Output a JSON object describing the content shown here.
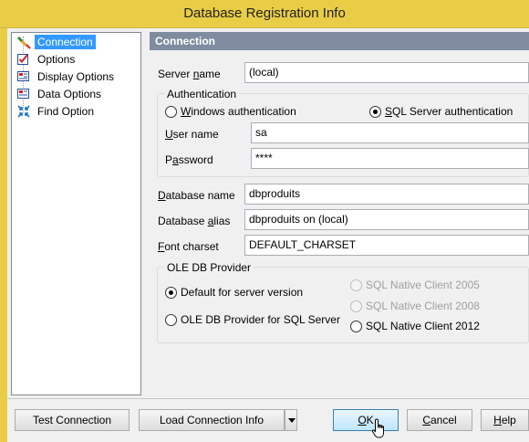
{
  "window": {
    "title": "Database Registration Info"
  },
  "tree": {
    "items": [
      {
        "label": "Connection",
        "icon": "connection-plug-icon",
        "selected": true
      },
      {
        "label": "Options",
        "icon": "options-checkbox-icon",
        "selected": false
      },
      {
        "label": "Display Options",
        "icon": "display-options-icon",
        "selected": false
      },
      {
        "label": "Data Options",
        "icon": "data-options-icon",
        "selected": false
      },
      {
        "label": "Find Option",
        "icon": "find-arrows-icon",
        "selected": false
      }
    ]
  },
  "section": {
    "title": "Connection"
  },
  "form": {
    "server_name": {
      "label_pre": "Server ",
      "label_ul": "n",
      "label_post": "ame",
      "value": "(local)"
    },
    "authentication": {
      "title": "Authentication",
      "windows": {
        "label_ul": "W",
        "label_post": "indows authentication",
        "selected": false
      },
      "sql": {
        "label_ul": "S",
        "label_post": "QL Server authentication",
        "selected": true
      },
      "user_name": {
        "label_ul": "U",
        "label_post": "ser name",
        "value": "sa"
      },
      "password": {
        "label_pre": "P",
        "label_ul": "a",
        "label_post": "ssword",
        "value": "****"
      }
    },
    "database_name": {
      "label_ul": "D",
      "label_post": "atabase name",
      "value": "dbproduits"
    },
    "database_alias": {
      "label_pre": "Database ",
      "label_ul": "a",
      "label_post": "lias",
      "value": "dbproduits on (local)"
    },
    "font_charset": {
      "label_ul": "F",
      "label_post": "ont charset",
      "value": "DEFAULT_CHARSET"
    },
    "ole_db": {
      "title": "OLE DB Provider",
      "default_version": {
        "label": "Default for server version",
        "selected": true
      },
      "provider_sql": {
        "label": "OLE DB Provider for SQL Server",
        "selected": false
      },
      "native_2005": {
        "label": "SQL Native Client 2005",
        "enabled": false
      },
      "native_2008": {
        "label": "SQL Native Client 2008",
        "enabled": false
      },
      "native_2012": {
        "label": "SQL Native Client 2012",
        "enabled": true
      }
    }
  },
  "buttons": {
    "test_connection": "Test Connection",
    "load_connection_info": "Load Connection Info",
    "ok_ul": "O",
    "ok_post": "K",
    "cancel_ul": "C",
    "cancel_post": "ancel",
    "help_ul": "H",
    "help_post": "elp"
  },
  "colors": {
    "title_bar": "#e9cd47",
    "header_bar": "#7f8ca0",
    "selection": "#3399ff"
  }
}
